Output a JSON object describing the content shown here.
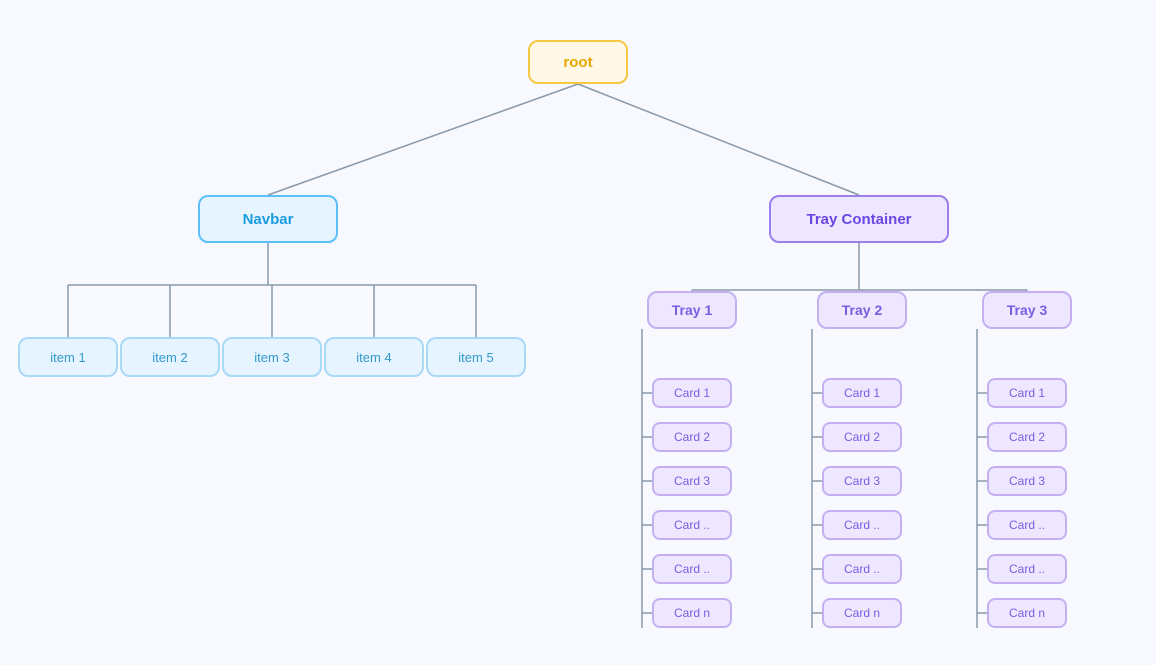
{
  "root": {
    "label": "root"
  },
  "navbar": {
    "label": "Navbar"
  },
  "tray_container": {
    "label": "Tray Container"
  },
  "items": [
    {
      "label": "item 1"
    },
    {
      "label": "item 2"
    },
    {
      "label": "item 3"
    },
    {
      "label": "item 4"
    },
    {
      "label": "item 5"
    }
  ],
  "trays": [
    {
      "label": "Tray 1",
      "cards": [
        "Card 1",
        "Card 2",
        "Card 3",
        "Card ..",
        "Card ..",
        "Card n"
      ]
    },
    {
      "label": "Tray 2",
      "cards": [
        "Card 1",
        "Card 2",
        "Card 3",
        "Card ..",
        "Card ..",
        "Card n"
      ]
    },
    {
      "label": "Tray 3",
      "cards": [
        "Card 1",
        "Card 2",
        "Card 3",
        "Card ..",
        "Card ..",
        "Card n"
      ]
    }
  ],
  "colors": {
    "line": "#8899aa"
  }
}
